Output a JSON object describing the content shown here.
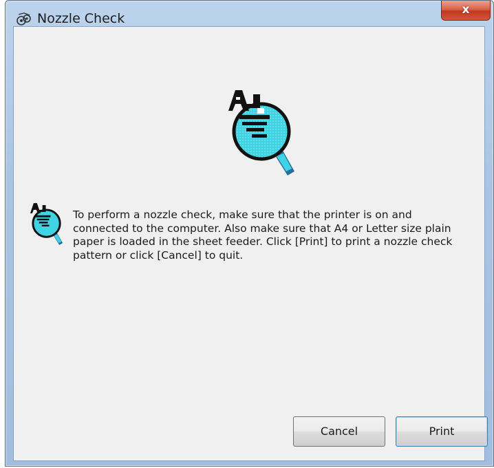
{
  "window": {
    "title": "Nozzle Check",
    "close_glyph": "x",
    "title_icon": "printer-utility-icon"
  },
  "content": {
    "main_icon": "nozzle-check-magnifier-icon",
    "message_icon": "nozzle-check-magnifier-icon",
    "message_lines": [
      "To perform a nozzle check, make sure that the printer is on and",
      "connected to the computer. Also make sure that A4 or Letter size plain",
      "paper is loaded in the sheet feeder. Click [Print] to print a nozzle check",
      "pattern or click [Cancel] to quit."
    ]
  },
  "buttons": {
    "cancel_label": "Cancel",
    "print_label": "Print"
  },
  "colors": {
    "lens_fill": "#3fd3e4",
    "dialog_bg": "#f0f0f0",
    "close_red": "#c1381f",
    "default_button_border": "#3c7fb1"
  }
}
